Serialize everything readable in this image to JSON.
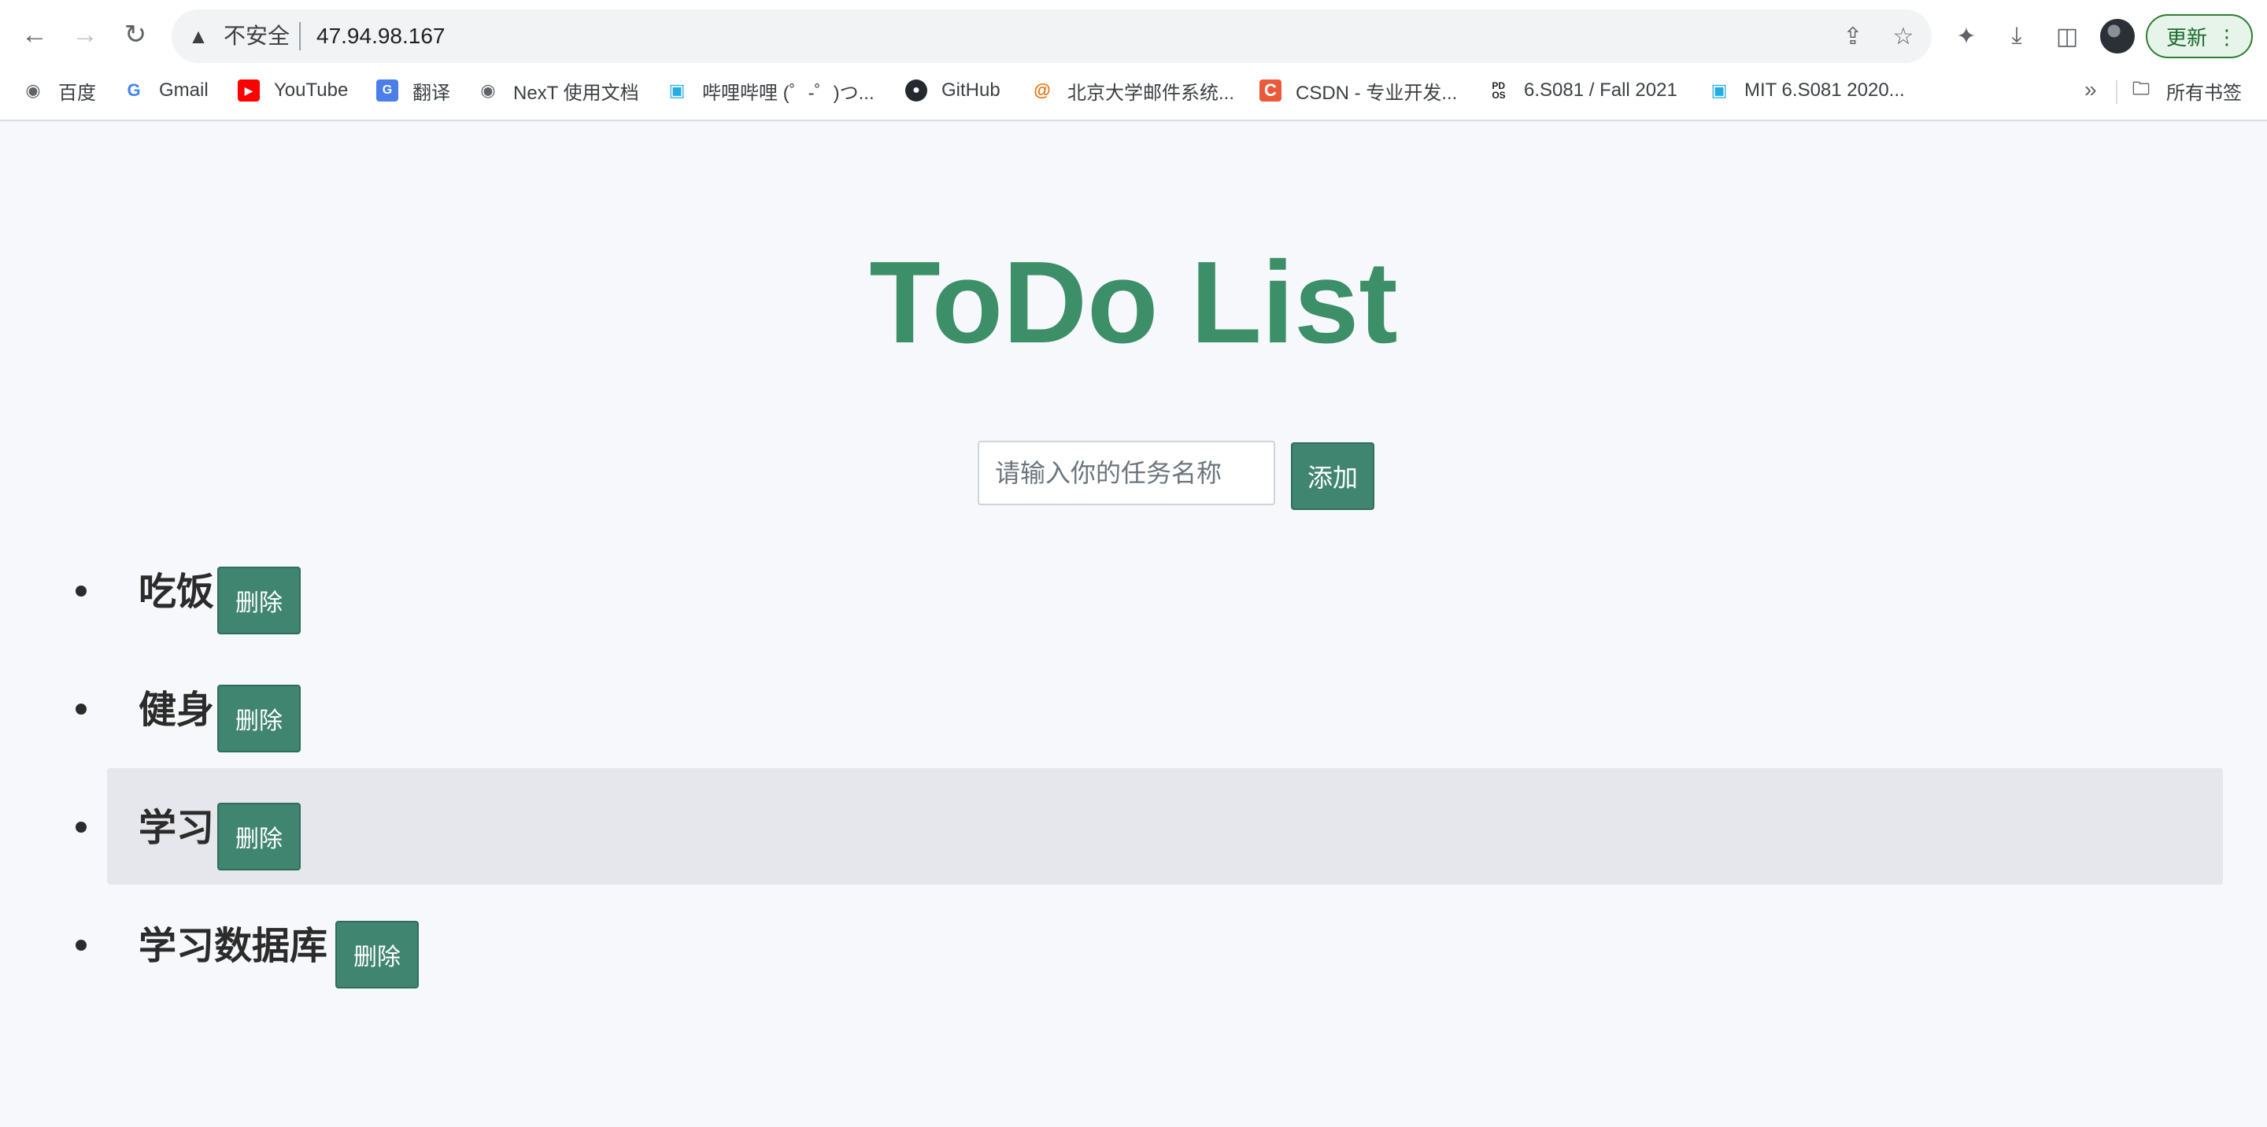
{
  "browser": {
    "security_label": "不安全",
    "url": "47.94.98.167",
    "update_label": "更新",
    "bookmarks": [
      {
        "label": "百度",
        "icon": "globe-icon"
      },
      {
        "label": "Gmail",
        "icon": "google-icon"
      },
      {
        "label": "YouTube",
        "icon": "youtube-icon"
      },
      {
        "label": "翻译",
        "icon": "translate-icon"
      },
      {
        "label": "NexT 使用文档",
        "icon": "globe-icon"
      },
      {
        "label": "哔哩哔哩 (゜-゜)つ...",
        "icon": "bilibili-icon"
      },
      {
        "label": "GitHub",
        "icon": "github-icon"
      },
      {
        "label": "北京大学邮件系统...",
        "icon": "mail-at-icon"
      },
      {
        "label": "CSDN - 专业开发...",
        "icon": "csdn-icon"
      },
      {
        "label": "6.S081 / Fall 2021",
        "icon": "pdos-icon"
      },
      {
        "label": "MIT 6.S081 2020...",
        "icon": "bilibili-icon"
      }
    ],
    "bookmarks_more": "»",
    "all_bookmarks_label": "所有书签"
  },
  "page": {
    "title": "ToDo List",
    "input_placeholder": "请输入你的任务名称",
    "input_value": "",
    "add_label": "添加",
    "delete_label": "删除",
    "todos": [
      "吃饭",
      "健身",
      "学习",
      "学习数据库"
    ]
  },
  "colors": {
    "title": "#3c8f68",
    "button": "#3f8570",
    "hover_row": "#e6e7ec",
    "background": "#f7f8fb"
  }
}
